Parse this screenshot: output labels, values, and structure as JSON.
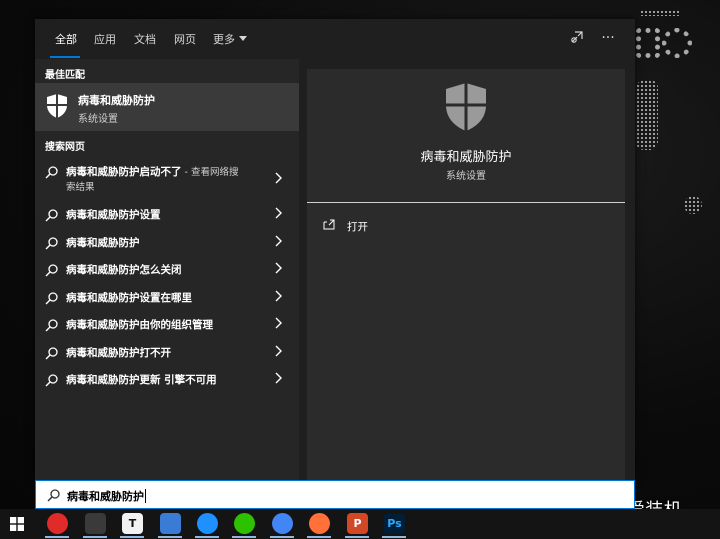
{
  "tabs": [
    {
      "label": "全部",
      "active": true
    },
    {
      "label": "应用",
      "active": false
    },
    {
      "label": "文档",
      "active": false
    },
    {
      "label": "网页",
      "active": false
    },
    {
      "label": "更多",
      "active": false
    }
  ],
  "top_icons": [
    "feedback-icon",
    "more-options-icon"
  ],
  "top_more_glyph": "···",
  "best_match": {
    "section": "最佳匹配",
    "title": "病毒和威胁防护",
    "subtitle": "系统设置",
    "icon": "shield-icon"
  },
  "web": {
    "section": "搜索网页",
    "items": [
      {
        "label": "病毒和威胁防护启动不了",
        "suffix": " - 查看网络搜",
        "line2": "索结果"
      },
      {
        "label": "病毒和威胁防护设置"
      },
      {
        "label": "病毒和威胁防护"
      },
      {
        "label": "病毒和威胁防护怎么关闭"
      },
      {
        "label": "病毒和威胁防护设置在哪里"
      },
      {
        "label": "病毒和威胁防护由你的组织管理"
      },
      {
        "label": "病毒和威胁防护打不开"
      },
      {
        "label": "病毒和威胁防护更新 引擎不可用"
      }
    ]
  },
  "preview": {
    "title": "病毒和威胁防护",
    "subtitle": "系统设置",
    "open_label": "打开"
  },
  "search": {
    "value": "病毒和威胁防护"
  },
  "taskbar": {
    "apps": [
      {
        "name": "netease-music-icon",
        "glyph": "",
        "color": "#e02b2b"
      },
      {
        "name": "sublime-icon",
        "glyph": "",
        "color": "#3a3a3a"
      },
      {
        "name": "typora-icon",
        "glyph": "T",
        "color": "#f2f2f2"
      },
      {
        "name": "feishu-icon",
        "glyph": "",
        "color": "#3a7bd5"
      },
      {
        "name": "qq-browser-icon",
        "glyph": "",
        "color": "#1e90ff"
      },
      {
        "name": "wechat-icon",
        "glyph": "",
        "color": "#2dc100"
      },
      {
        "name": "chrome-icon",
        "glyph": "",
        "color": "#4285f4"
      },
      {
        "name": "firefox-icon",
        "glyph": "",
        "color": "#ff7139"
      },
      {
        "name": "powerpoint-icon",
        "glyph": "P",
        "color": "#d24726"
      },
      {
        "name": "photoshop-icon",
        "glyph": "Ps",
        "color": "#001e36"
      }
    ]
  },
  "watermark": "知乎 @小白爱装机"
}
